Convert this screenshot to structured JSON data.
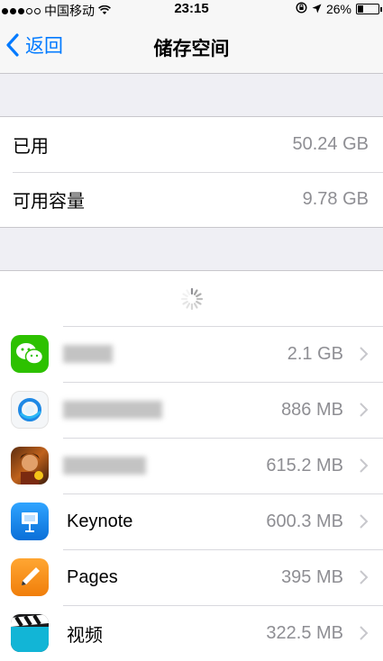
{
  "status": {
    "carrier": "中国移动",
    "time": "23:15",
    "battery": "26%",
    "battery_level": 0.26
  },
  "nav": {
    "back_label": "返回",
    "title": "储存空间"
  },
  "storage": {
    "used_label": "已用",
    "used_value": "50.24 GB",
    "available_label": "可用容量",
    "available_value": "9.78 GB"
  },
  "apps": [
    {
      "name": "",
      "size": "2.1 GB",
      "icon": "wechat-icon"
    },
    {
      "name": "",
      "size": "886 MB",
      "icon": "qq-browser-icon"
    },
    {
      "name": "",
      "size": "615.2 MB",
      "icon": "game-icon"
    },
    {
      "name": "Keynote",
      "size": "600.3 MB",
      "icon": "keynote-icon"
    },
    {
      "name": "Pages",
      "size": "395 MB",
      "icon": "pages-icon"
    },
    {
      "name": "视频",
      "size": "322.5 MB",
      "icon": "videos-icon"
    }
  ],
  "colors": {
    "accent": "#007aff",
    "wechat": "#2dc100",
    "keynote": "#1a8cf0",
    "pages": "#f2900f"
  }
}
